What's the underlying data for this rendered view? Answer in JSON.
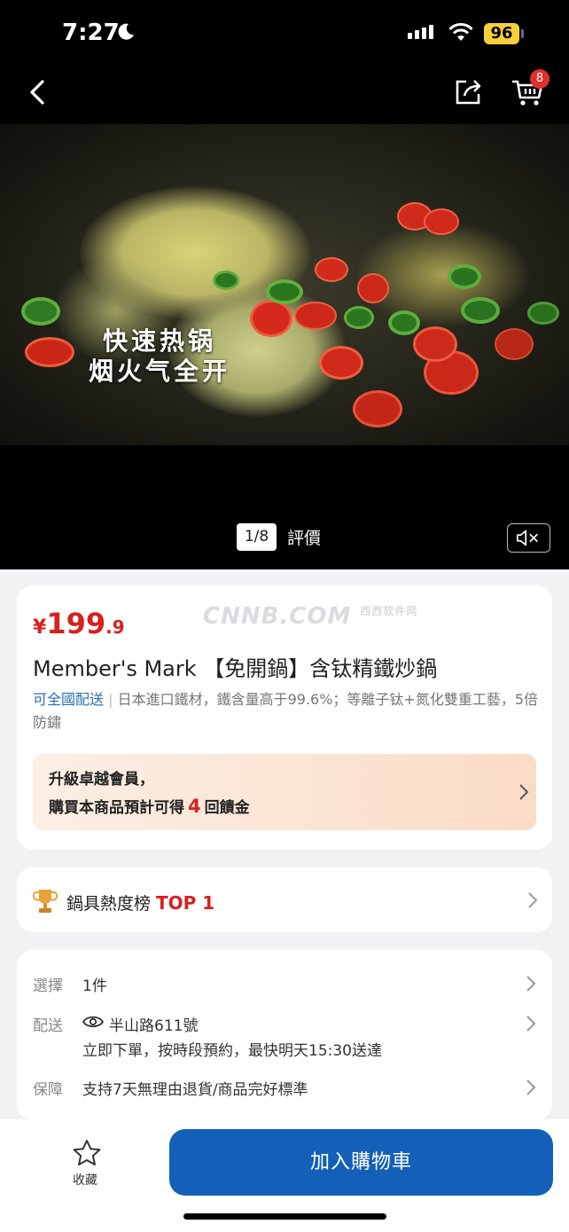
{
  "status_bar": {
    "time": "7:27",
    "battery": "96",
    "moon_icon": "moon-icon",
    "wifi_icon": "wifi-icon",
    "signal_icon": "signal-icon"
  },
  "nav": {
    "back_icon": "chevron-left-icon",
    "share_icon": "share-icon",
    "cart_icon": "cart-icon",
    "cart_count": "8"
  },
  "media": {
    "caption_line1": "快速热锅",
    "caption_line2": "烟火气全开",
    "page_indicator": "1/8",
    "review_label": "評價",
    "mute_icon": "speaker-mute-icon"
  },
  "product": {
    "currency": "¥",
    "price_int": "199",
    "price_dec": ".9",
    "watermark": "CNNB.COM",
    "watermark_small": "西西软件网",
    "title": "Member's Mark 【免開鍋】含钛精鐵炒鍋",
    "delivery_tag": "可全國配送",
    "description": "日本進口鐵材，鐵含量高于99.6%；等離子钛+氮化雙重工藝，5倍防鏽",
    "promo_line1": "升級卓越會員，",
    "promo_line2_prefix": "購買本商品預計可得",
    "promo_points": "4",
    "promo_line2_suffix": "回饋金"
  },
  "ranking": {
    "icon": "trophy-icon",
    "label": "鍋具熱度榜",
    "rank": "TOP 1"
  },
  "details": {
    "select_label": "選擇",
    "select_value": "1件",
    "delivery_label": "配送",
    "delivery_address": "半山路611號",
    "delivery_note": "立即下單，按時段預約，最快明天15:30送達",
    "guarantee_label": "保障",
    "guarantee_value": "支持7天無理由退貨/商品完好標準"
  },
  "bottom": {
    "favorite_label": "收藏",
    "add_to_cart": "加入購物車"
  },
  "colors": {
    "price_red": "#d7201f",
    "primary_blue": "#1460b8",
    "link_blue": "#2a6fb8",
    "battery_yellow": "#f7d038"
  }
}
